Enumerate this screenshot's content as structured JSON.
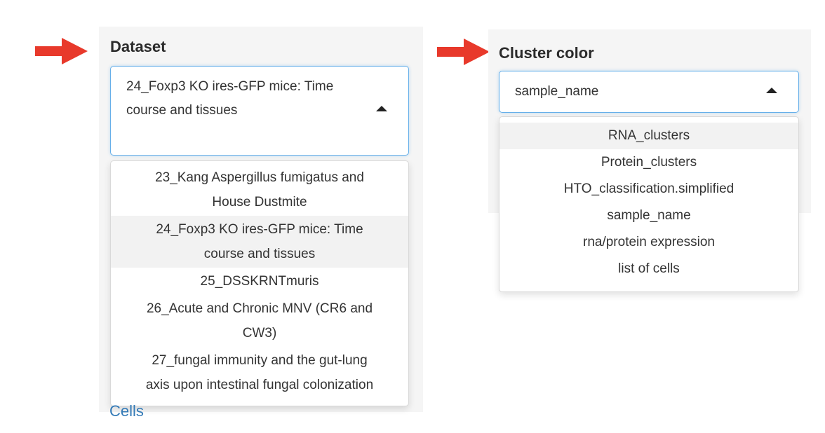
{
  "colors": {
    "arrow": "#e8392b",
    "focus_border": "#66afe9",
    "panel_bg": "#f5f5f5",
    "active_option_bg": "#f2f2f2",
    "link": "#337ab7"
  },
  "dataset": {
    "label": "Dataset",
    "selected_line1": "24_Foxp3 KO ires-GFP mice: Time",
    "selected_line2": "course and tissues",
    "options": [
      {
        "line1": "23_Kang Aspergillus fumigatus and",
        "line2": "House Dustmite"
      },
      {
        "line1": "24_Foxp3 KO ires-GFP mice: Time",
        "line2": "course and tissues"
      },
      {
        "line1": "25_DSSKRNTmuris",
        "line2": ""
      },
      {
        "line1": "26_Acute and Chronic MNV (CR6 and",
        "line2": "CW3)"
      },
      {
        "line1": "27_fungal immunity and the gut-lung",
        "line2": "axis upon intestinal fungal colonization"
      }
    ],
    "active_index": 1
  },
  "cluster_color": {
    "label": "Cluster color",
    "selected": "sample_name",
    "options": [
      "RNA_clusters",
      "Protein_clusters",
      "HTO_classification.simplified",
      "sample_name",
      "rna/protein expression",
      "list of cells"
    ],
    "active_index": 0
  },
  "footer_link": "Cells",
  "icons": {
    "arrow": "arrow-right-icon",
    "caret": "caret-up-icon"
  }
}
